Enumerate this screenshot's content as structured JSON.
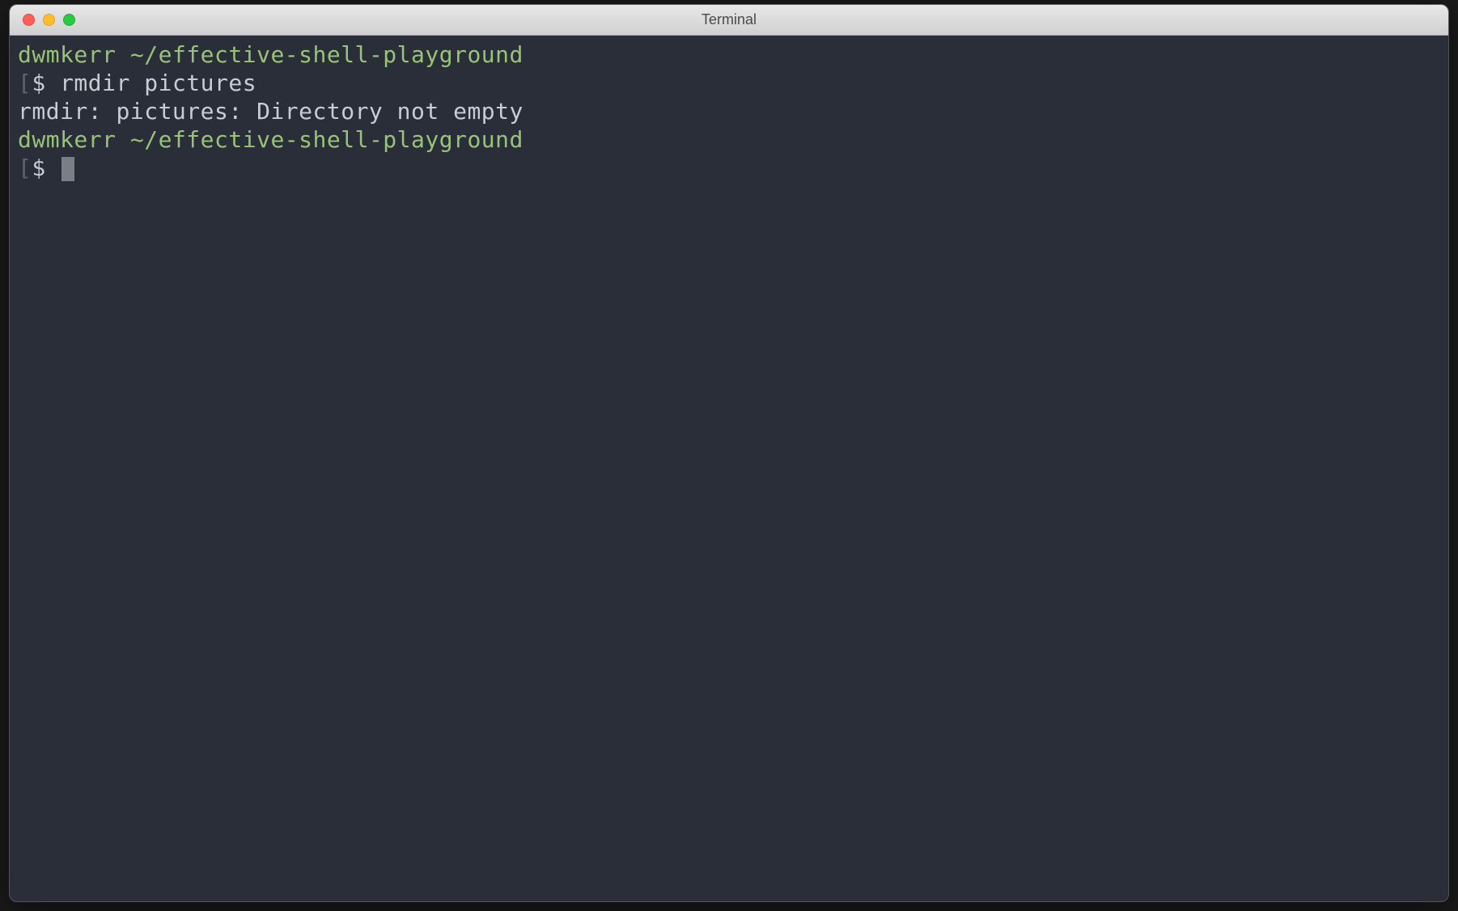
{
  "window": {
    "title": "Terminal"
  },
  "terminal": {
    "lines": [
      {
        "user": "dwmkerr",
        "path": "~/effective-shell-playground"
      },
      {
        "symbol": "$ ",
        "command": "rmdir pictures"
      },
      {
        "output": "rmdir: pictures: Directory not empty"
      },
      {
        "user": "dwmkerr",
        "path": "~/effective-shell-playground"
      },
      {
        "symbol": "$ "
      }
    ]
  }
}
